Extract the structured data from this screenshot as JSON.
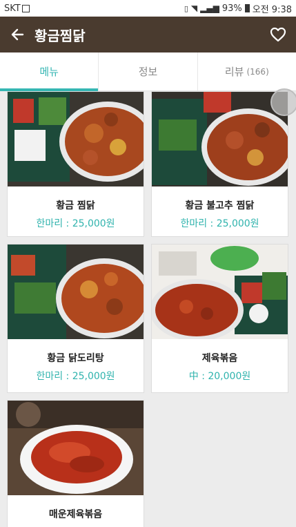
{
  "status_bar": {
    "carrier": "SKT",
    "battery": "93%",
    "time": "오전 9:38"
  },
  "app_bar": {
    "title": "황금찜닭"
  },
  "tabs": [
    {
      "label": "메뉴",
      "count": ""
    },
    {
      "label": "정보",
      "count": ""
    },
    {
      "label": "리뷰",
      "count": "(166)"
    }
  ],
  "menu": [
    {
      "name": "황금 찜닭",
      "price": "한마리 : 25,000원"
    },
    {
      "name": "황금 불고추 찜닭",
      "price": "한마리 : 25,000원"
    },
    {
      "name": "황금 닭도리탕",
      "price": "한마리 : 25,000원"
    },
    {
      "name": "제육볶음",
      "price": "中 : 20,000원"
    },
    {
      "name": "매운제육볶음",
      "price": ""
    }
  ],
  "colors": {
    "app_bar": "#4a3b2f",
    "accent": "#35b6b3"
  }
}
